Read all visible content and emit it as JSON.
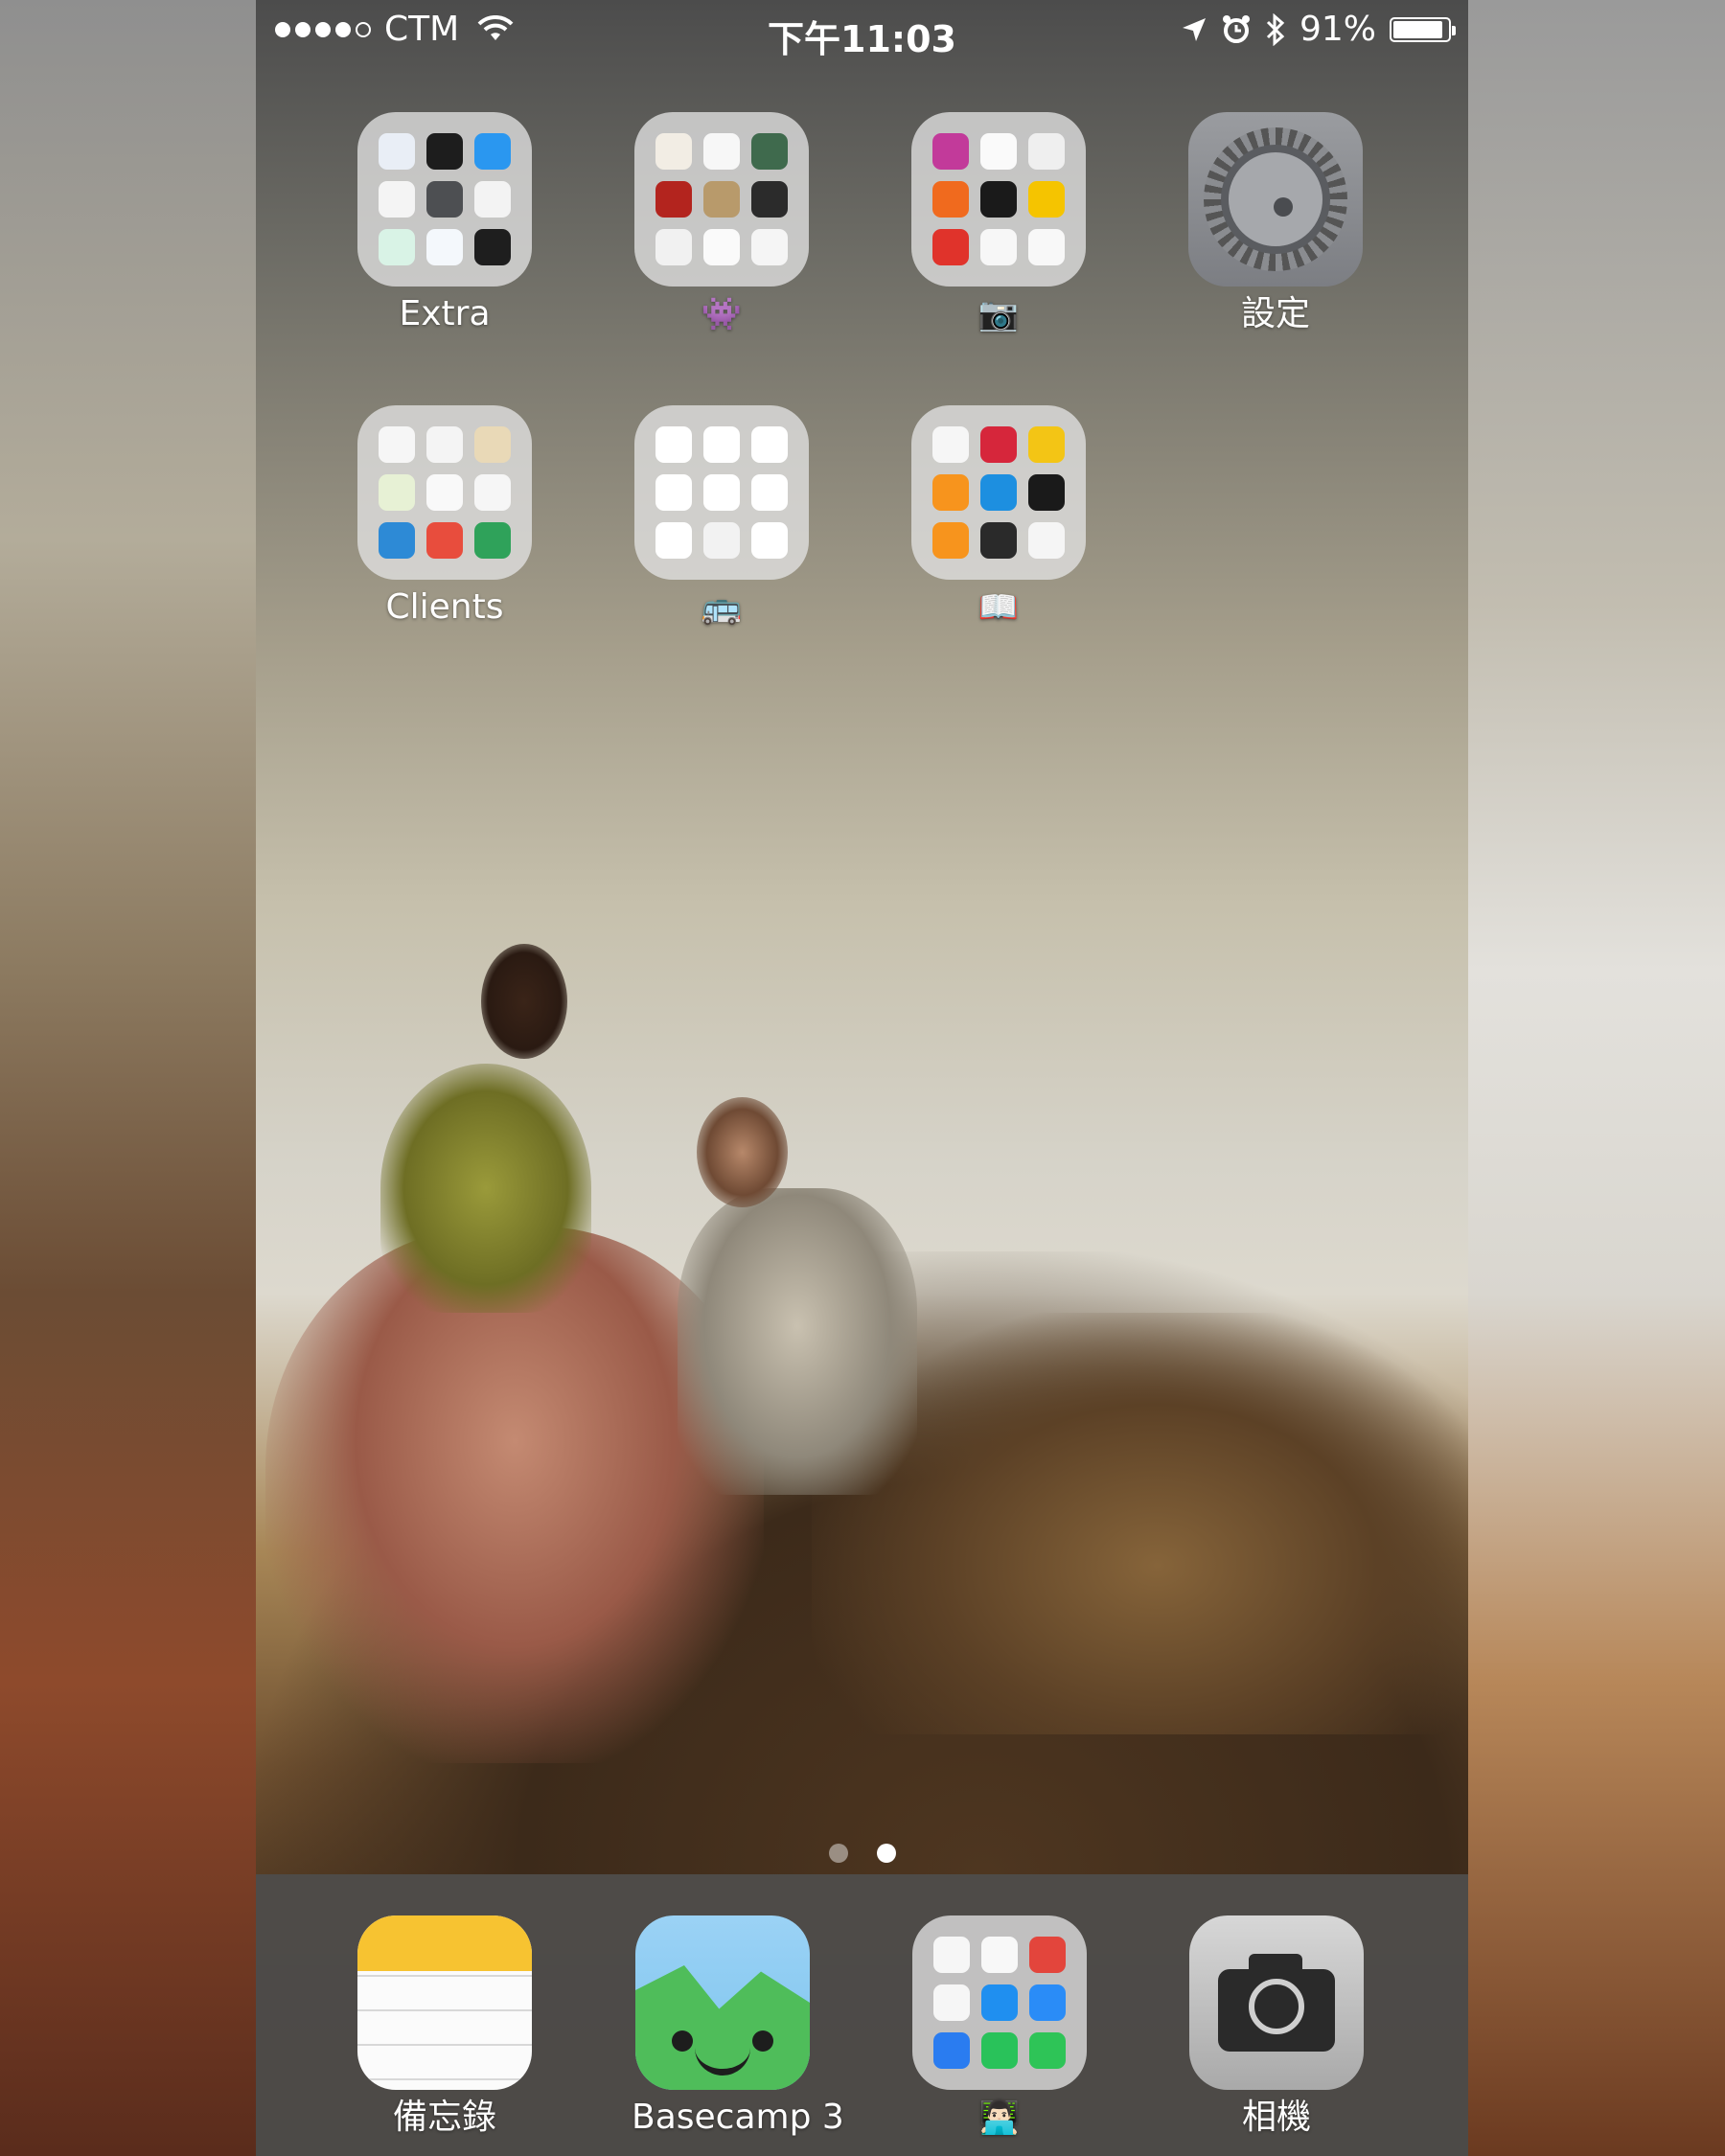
{
  "status_bar": {
    "carrier": "CTM",
    "time": "下午11:03",
    "battery_percent": "91%",
    "battery_level": 0.91,
    "signal_bars": 4,
    "signal_max": 5,
    "icons": [
      "wifi-icon",
      "location-arrow-icon",
      "alarm-icon",
      "bluetooth-icon",
      "battery-icon"
    ]
  },
  "home_screen": {
    "rows": [
      [
        {
          "label": "Extra",
          "kind": "folder",
          "mini_colors": [
            "#e9eef6",
            "#1d1d1d",
            "#2a97f0",
            "#f4f4f4",
            "#4d4f52",
            "#f3f3f3",
            "#d9f3e6",
            "#f4f8fc",
            "#1e1e1e"
          ]
        },
        {
          "label": "👾",
          "kind": "folder",
          "mini_colors": [
            "#f2ede4",
            "#f7f7f7",
            "#3f6a4d",
            "#b3241e",
            "#b89a6b",
            "#2b2b2b",
            "#f1f1f1",
            "#fafafa",
            "#f5f5f5"
          ]
        },
        {
          "label": "📷",
          "kind": "folder",
          "mini_colors": [
            "#c23a9a",
            "#fafafa",
            "#efefef",
            "#f06a1e",
            "#1a1a1a",
            "#f5c400",
            "#e0332b",
            "#f7f7f7",
            "#f8f8f8"
          ]
        },
        {
          "label": "設定",
          "kind": "app",
          "icon": "settings-gear-icon"
        }
      ],
      [
        {
          "label": "Clients",
          "kind": "folder",
          "mini_colors": [
            "#f6f6f6",
            "#f4f4f4",
            "#e9d9b7",
            "#e7f1d5",
            "#f9f9f9",
            "#f6f6f6",
            "#2d8ad6",
            "#e84d3d",
            "#2fa25a"
          ]
        },
        {
          "label": "🚌",
          "kind": "folder",
          "mini_colors": [
            "#ffffff",
            "#ffffff",
            "#ffffff",
            "#ffffff",
            "#ffffff",
            "#ffffff",
            "#ffffff",
            "#f2f2f2",
            "#ffffff"
          ]
        },
        {
          "label": "📖",
          "kind": "folder",
          "mini_colors": [
            "#f6f6f6",
            "#d6263b",
            "#f3c515",
            "#f7941d",
            "#1d8fe0",
            "#1a1a1a",
            "#f7941d",
            "#2a2a2a",
            "#f5f5f5"
          ]
        }
      ]
    ]
  },
  "page_indicator": {
    "pages": 2,
    "current": 2
  },
  "dock": [
    {
      "label": "備忘錄",
      "kind": "app",
      "icon": "notes-icon"
    },
    {
      "label": "Basecamp 3",
      "kind": "app",
      "icon": "basecamp-icon"
    },
    {
      "label": "👨🏻‍💻",
      "kind": "folder",
      "mini_colors": [
        "#f6f6f6",
        "#f8f8f8",
        "#e3453c",
        "#f6f6f6",
        "#1f8ff0",
        "#2a8cf7",
        "#2a7cf0",
        "#29c25a",
        "#2ec457"
      ]
    },
    {
      "label": "相機",
      "kind": "app",
      "icon": "camera-icon"
    }
  ],
  "colors": {
    "label_text": "#ffffff",
    "dock_bg": "#4e4c4a"
  }
}
